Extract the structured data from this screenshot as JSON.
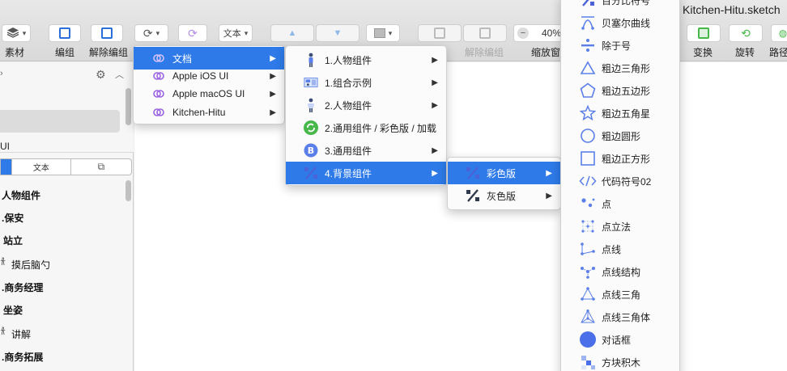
{
  "window": {
    "title": "Kitchen-Hitu.sketch"
  },
  "toolbar": {
    "zoom_value": "40%",
    "text_dropdown": "文本",
    "labels": {
      "material": "素材",
      "group": "编组",
      "ungroup": "解除编组",
      "ungroup2": "解除编组",
      "zoom_window": "缩放窗口",
      "transform": "变换",
      "rotate": "旋转",
      "path": "路径"
    }
  },
  "left_panel": {
    "ui_label": "UI",
    "tabs": {
      "text": "文本"
    },
    "items": [
      "人物组件",
      ".保安",
      "站立",
      "摸后脑勺",
      ".商务经理",
      "坐姿",
      "讲解",
      ".商务拓展"
    ]
  },
  "menu_level1": {
    "items": [
      {
        "label": "文档"
      },
      {
        "label": "Apple iOS UI"
      },
      {
        "label": "Apple macOS UI"
      },
      {
        "label": "Kitchen-Hitu"
      }
    ]
  },
  "menu_level2": {
    "items": [
      {
        "label": "1.人物组件"
      },
      {
        "label": "1.组合示例"
      },
      {
        "label": "2.人物组件"
      },
      {
        "label": "2.通用组件 / 彩色版 / 加载"
      },
      {
        "label": "3.通用组件"
      },
      {
        "label": "4.背景组件"
      }
    ]
  },
  "menu_level3": {
    "items": [
      {
        "label": "彩色版"
      },
      {
        "label": "灰色版"
      }
    ]
  },
  "menu_level4": {
    "items": [
      {
        "label": "百分比符号"
      },
      {
        "label": "贝塞尔曲线"
      },
      {
        "label": "除于号"
      },
      {
        "label": "粗边三角形"
      },
      {
        "label": "粗边五边形"
      },
      {
        "label": "粗边五角星"
      },
      {
        "label": "粗边圆形"
      },
      {
        "label": "粗边正方形"
      },
      {
        "label": "代码符号02"
      },
      {
        "label": "点"
      },
      {
        "label": "点立法"
      },
      {
        "label": "点线"
      },
      {
        "label": "点线结构"
      },
      {
        "label": "点线三角"
      },
      {
        "label": "点线三角体"
      },
      {
        "label": "对话框"
      },
      {
        "label": "方块积木"
      }
    ]
  },
  "colors": {
    "accent": "#2d7ae8",
    "icon_blue": "#5a7fe8",
    "link_purple": "#9a62e0",
    "loading_green": "#47b74a"
  }
}
